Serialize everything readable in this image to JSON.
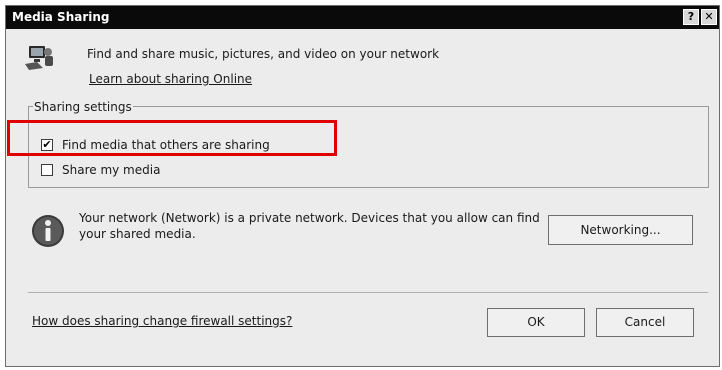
{
  "window": {
    "title": "Media Sharing",
    "help_label": "?",
    "close_label": "✕"
  },
  "intro": {
    "text": "Find and share music, pictures, and video on your network",
    "link": "Learn about sharing Online"
  },
  "sharing_settings": {
    "legend": "Sharing settings",
    "find_media_label": "Find media that others are sharing",
    "find_media_checked": true,
    "share_my_media_label": "Share my media",
    "share_my_media_checked": false,
    "highlight_color": "#e00000"
  },
  "network": {
    "text": "Your network (Network) is a private network. Devices that you allow can find your shared media.",
    "button_label": "Networking..."
  },
  "footer": {
    "firewall_link": "How does sharing change firewall settings?",
    "ok_label": "OK",
    "cancel_label": "Cancel"
  },
  "icons": [
    "media-sharing-icon",
    "info-icon",
    "checkbox-checked-icon",
    "help-icon",
    "close-icon"
  ]
}
